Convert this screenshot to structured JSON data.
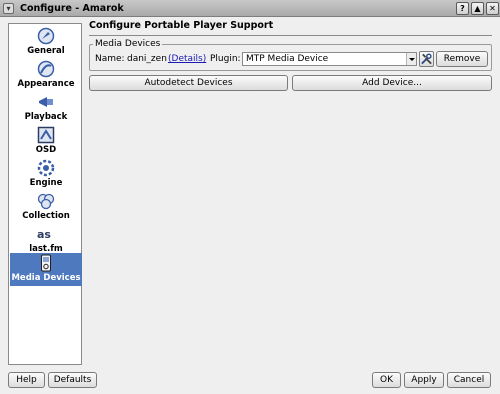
{
  "window": {
    "title": "Configure - Amarok",
    "buttons": {
      "help": "?",
      "keep_above": "▲",
      "close": "✕"
    }
  },
  "sidebar": {
    "items": [
      {
        "label": "General",
        "icon": "general-icon",
        "active": false
      },
      {
        "label": "Appearance",
        "icon": "appearance-icon",
        "active": false
      },
      {
        "label": "Playback",
        "icon": "playback-icon",
        "active": false
      },
      {
        "label": "OSD",
        "icon": "osd-icon",
        "active": false
      },
      {
        "label": "Engine",
        "icon": "engine-icon",
        "active": false
      },
      {
        "label": "Collection",
        "icon": "collection-icon",
        "active": false
      },
      {
        "label": "last.fm",
        "icon": "lastfm-icon",
        "active": false
      },
      {
        "label": "Media Devices",
        "icon": "media-devices-icon",
        "active": true
      }
    ]
  },
  "main": {
    "heading": "Configure Portable Player Support",
    "group_title": "Media Devices",
    "device": {
      "name_label": "Name:",
      "name_value": "dani_zen",
      "details_link": "(Details)",
      "plugin_label": "Plugin:",
      "plugin_value": "MTP Media Device",
      "remove_label": "Remove"
    },
    "autodetect_label": "Autodetect Devices",
    "add_device_label": "Add Device..."
  },
  "footer": {
    "help_label": "Help",
    "defaults_label": "Defaults",
    "ok_label": "OK",
    "apply_label": "Apply",
    "cancel_label": "Cancel"
  },
  "colors": {
    "selection": "#4e79be",
    "link": "#1b1bb0",
    "icon_blue": "#3a5ea8"
  }
}
